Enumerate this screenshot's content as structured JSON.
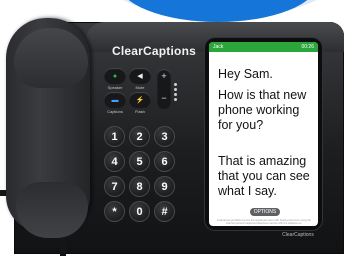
{
  "brand": "ClearCaptions",
  "function_buttons": [
    {
      "label": "Speaker",
      "icon": "speaker-icon",
      "color": "#33b34a"
    },
    {
      "label": "Mute",
      "icon": "mute-icon",
      "color": "#f0f0f0"
    },
    {
      "label": "Captions",
      "icon": "captions-icon",
      "color": "#3fa0ff"
    },
    {
      "label": "Flash",
      "icon": "flash-icon",
      "color": "#f0f0f0"
    }
  ],
  "volume": {
    "plus": "+",
    "minus": "−"
  },
  "keypad": [
    "1",
    "2",
    "3",
    "4",
    "5",
    "6",
    "7",
    "8",
    "9",
    "*",
    "0",
    "#"
  ],
  "screen": {
    "contact": "Jack",
    "time": "00:26",
    "captions": [
      "Hey Sam.",
      "How is that new phone working for you?",
      "That is amazing that you can see what I say."
    ],
    "options_label": "OPTIONS",
    "footnote": "Federal law prohibits anyone but registered users with hearing loss from using the internet protocol captioned telephone service with the captions on."
  },
  "stand_text": "ClearCaptions",
  "colors": {
    "header_green": "#2aa63b",
    "accent_blue": "#0a6fd6",
    "body_black": "#1d1e20"
  }
}
